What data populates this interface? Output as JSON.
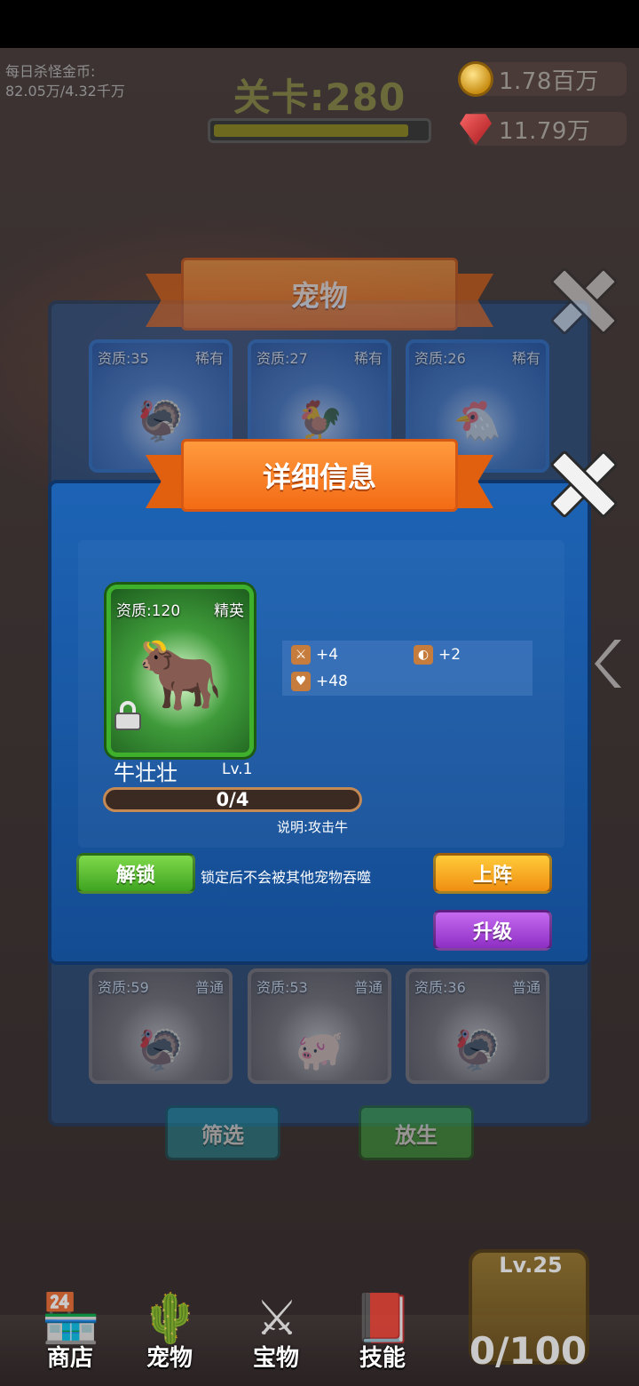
{
  "hud": {
    "daily_label": "每日杀怪金币:",
    "daily_value": "82.05万/4.32千万",
    "level_title": "关卡:280",
    "level_progress": 0.93,
    "gold": "1.78百万",
    "gems": "11.79万"
  },
  "pet_panel": {
    "title": "宠物",
    "top_cards": [
      {
        "quality": "资质:35",
        "rarity": "稀有",
        "pet": "turkey"
      },
      {
        "quality": "资质:27",
        "rarity": "稀有",
        "pet": "rooster"
      },
      {
        "quality": "资质:26",
        "rarity": "稀有",
        "pet": "chicken"
      }
    ],
    "bottom_cards": [
      {
        "quality": "资质:59",
        "rarity": "普通",
        "pet": "turkey"
      },
      {
        "quality": "资质:53",
        "rarity": "普通",
        "pet": "pig"
      },
      {
        "quality": "资质:36",
        "rarity": "普通",
        "pet": "turkey"
      }
    ],
    "filter_label": "筛选",
    "release_label": "放生"
  },
  "detail": {
    "title": "详细信息",
    "card": {
      "quality": "资质:120",
      "rarity": "精英",
      "pet": "bull"
    },
    "name": "牛壮壮",
    "level": "Lv.1",
    "xp_text": "0/4",
    "description": "说明:攻击牛",
    "stats": [
      {
        "icon": "sword-icon",
        "value": "+4"
      },
      {
        "icon": "shield-icon",
        "value": "+2"
      },
      {
        "icon": "heart-icon",
        "value": "+48"
      }
    ],
    "unlock_label": "解锁",
    "lock_note": "锁定后不会被其他宠物吞噬",
    "deploy_label": "上阵",
    "upgrade_label": "升级"
  },
  "nav": {
    "shop": "商店",
    "pets": "宠物",
    "treasure": "宝物",
    "skills": "技能",
    "chest_level": "Lv.25",
    "chest_count": "0/100"
  },
  "colors": {
    "green_button": "#5cc32c",
    "orange_button": "#f4a21c",
    "purple_button": "#a63fd6",
    "teal_button": "#1e7a86",
    "ribbon": "#f36b15"
  }
}
